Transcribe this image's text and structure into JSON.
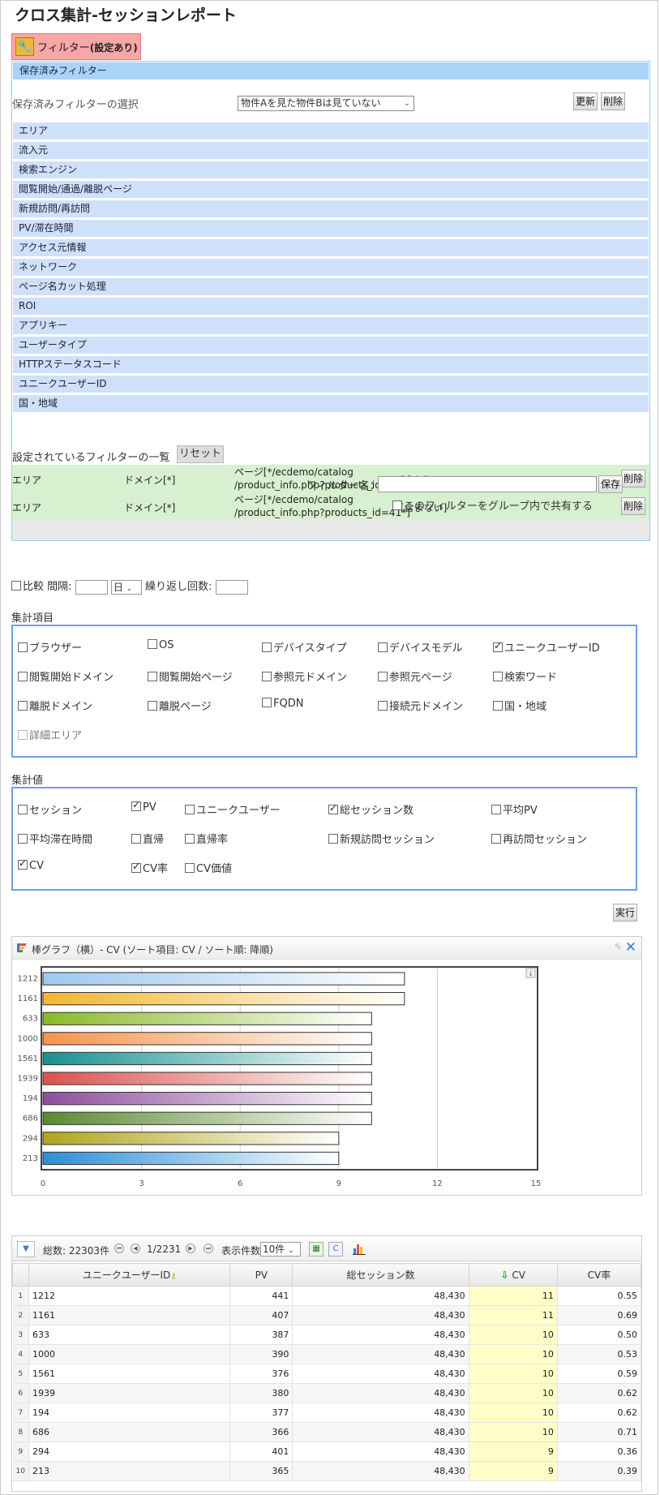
{
  "page": {
    "title": "クロス集計-セッションレポート"
  },
  "filter": {
    "button_label": "フィルター",
    "button_sub": "(設定あり)",
    "saved_header": "保存済みフィルター",
    "saved_select_label": "保存済みフィルターの選択",
    "saved_select_value": "物件Aを見た物件Bは見ていない",
    "update_label": "更新",
    "delete_label": "削除",
    "categories": [
      "エリア",
      "流入元",
      "検索エンジン",
      "閲覧開始/通過/離脱ページ",
      "新規訪問/再訪問",
      "PV/滞在時間",
      "アクセス元情報",
      "ネットワーク",
      "ページ名カット処理",
      "ROI",
      "アプリキー",
      "ユーザータイプ",
      "HTTPステータスコード",
      "ユニークユーザーID",
      "国・地域"
    ],
    "list_title": "設定されているフィルターの一覧",
    "reset_label": "リセット",
    "rows": [
      {
        "area": "エリア",
        "domain": "ドメイン[*]",
        "page_line1": "ページ[*/ecdemo/catalog",
        "page_line2": "/product_info.php?products_id=40*]",
        "cond": "[含む]",
        "delete": "削除"
      },
      {
        "area": "エリア",
        "domain": "ドメイン[*]",
        "page_line1": "ページ[*/ecdemo/catalog",
        "page_line2": "/product_info.php?products_id=41*]",
        "cond": "[含まない]",
        "delete": "削除"
      }
    ],
    "name_label": "フィルター名：",
    "save_label": "保存",
    "share_label": "このフィルターをグループ内で共有する"
  },
  "compare": {
    "label": "比較",
    "interval_label": "間隔:",
    "unit": "日",
    "repeat_label": "繰り返し回数:"
  },
  "agg_items": {
    "title": "集計項目",
    "items": [
      {
        "label": "ブラウザー",
        "checked": false
      },
      {
        "label": "OS",
        "checked": false
      },
      {
        "label": "デバイスタイプ",
        "checked": false
      },
      {
        "label": "デバイスモデル",
        "checked": false
      },
      {
        "label": "ユニークユーザーID",
        "checked": true
      },
      {
        "label": "閲覧開始ドメイン",
        "checked": false
      },
      {
        "label": "閲覧開始ページ",
        "checked": false
      },
      {
        "label": "参照元ドメイン",
        "checked": false
      },
      {
        "label": "参照元ページ",
        "checked": false
      },
      {
        "label": "検索ワード",
        "checked": false
      },
      {
        "label": "離脱ドメイン",
        "checked": false
      },
      {
        "label": "離脱ページ",
        "checked": false
      },
      {
        "label": "FQDN",
        "checked": false
      },
      {
        "label": "接続元ドメイン",
        "checked": false
      },
      {
        "label": "国・地域",
        "checked": false
      },
      {
        "label": "詳細エリア",
        "checked": false,
        "disabled": true
      }
    ]
  },
  "agg_values": {
    "title": "集計値",
    "items": [
      {
        "label": "セッション",
        "checked": false
      },
      {
        "label": "PV",
        "checked": true
      },
      {
        "label": "ユニークユーザー",
        "checked": false
      },
      {
        "label": "総セッション数",
        "checked": true
      },
      {
        "label": "平均PV",
        "checked": false
      },
      {
        "label": "平均滞在時間",
        "checked": false
      },
      {
        "label": "直帰",
        "checked": false
      },
      {
        "label": "直帰率",
        "checked": false
      },
      {
        "label": "新規訪問セッション",
        "checked": false
      },
      {
        "label": "再訪問セッション",
        "checked": false
      },
      {
        "label": "CV",
        "checked": true
      },
      {
        "label": "CV率",
        "checked": true
      },
      {
        "label": "CV価値",
        "checked": false
      }
    ]
  },
  "run_label": "実行",
  "chart_data": {
    "type": "bar",
    "orientation": "horizontal",
    "title": "棒グラフ（横）- CV (ソート項目: CV / ソート順: 降順)",
    "categories": [
      "1212",
      "1161",
      "633",
      "1000",
      "1561",
      "1939",
      "194",
      "686",
      "294",
      "213"
    ],
    "values": [
      11,
      11,
      10,
      10,
      10,
      10,
      10,
      10,
      9,
      9
    ],
    "xlim": [
      0,
      15
    ],
    "xticks": [
      "0",
      "3",
      "6",
      "9",
      "12",
      "15"
    ],
    "colors": [
      "#9ec9ef",
      "#f2b632",
      "#8ab92a",
      "#f7934c",
      "#17918f",
      "#d9534f",
      "#8e4f9c",
      "#5b8a32",
      "#b0a51c",
      "#2a8fd8"
    ]
  },
  "grid": {
    "total_label": "総数: 22303件",
    "page_label": "1/2231",
    "per_page_label": "表示件数",
    "per_page_value": "10件",
    "columns": [
      "ユニークユーザーID",
      "PV",
      "総セッション数",
      "CV",
      "CV率"
    ],
    "rows": [
      [
        "1",
        "1212",
        "441",
        "48,430",
        "11",
        "0.55"
      ],
      [
        "2",
        "1161",
        "407",
        "48,430",
        "11",
        "0.69"
      ],
      [
        "3",
        "633",
        "387",
        "48,430",
        "10",
        "0.50"
      ],
      [
        "4",
        "1000",
        "390",
        "48,430",
        "10",
        "0.53"
      ],
      [
        "5",
        "1561",
        "376",
        "48,430",
        "10",
        "0.59"
      ],
      [
        "6",
        "1939",
        "380",
        "48,430",
        "10",
        "0.62"
      ],
      [
        "7",
        "194",
        "377",
        "48,430",
        "10",
        "0.62"
      ],
      [
        "8",
        "686",
        "366",
        "48,430",
        "10",
        "0.71"
      ],
      [
        "9",
        "294",
        "401",
        "48,430",
        "9",
        "0.36"
      ],
      [
        "10",
        "213",
        "365",
        "48,430",
        "9",
        "0.39"
      ]
    ]
  }
}
